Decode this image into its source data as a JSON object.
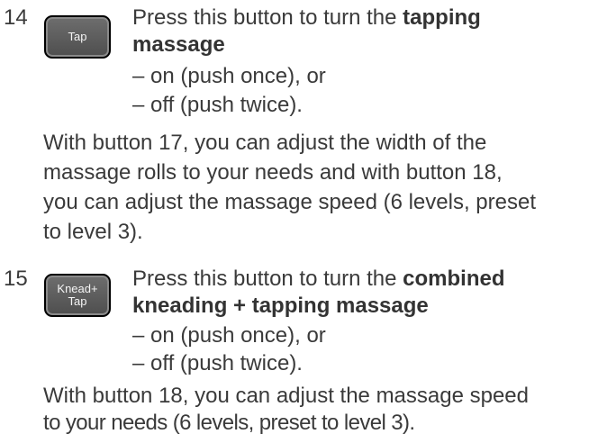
{
  "items": [
    {
      "number": "14",
      "button_lines": [
        "Tap"
      ],
      "intro": "Press this button to turn the",
      "title_line1": "tapping",
      "title_line2": "massage",
      "option_on": "– on (push once), or",
      "option_off": "– off (push twice).",
      "desc_lines": [
        "With button 17, you can adjust the width of the",
        "massage rolls to your needs and with button 18,",
        "you can adjust the massage speed (6 levels, preset",
        "to level 3)."
      ]
    },
    {
      "number": "15",
      "button_lines": [
        "Knead+",
        "Tap"
      ],
      "intro": "Press this button to turn the",
      "title_line1": "combined",
      "title_line2": "kneading + tapping massage",
      "option_on": "– on (push once), or",
      "option_off": "– off (push twice).",
      "desc_lines": [
        "With button 18, you can adjust the massage speed",
        "to your needs (6 levels, preset to level 3)."
      ]
    }
  ]
}
